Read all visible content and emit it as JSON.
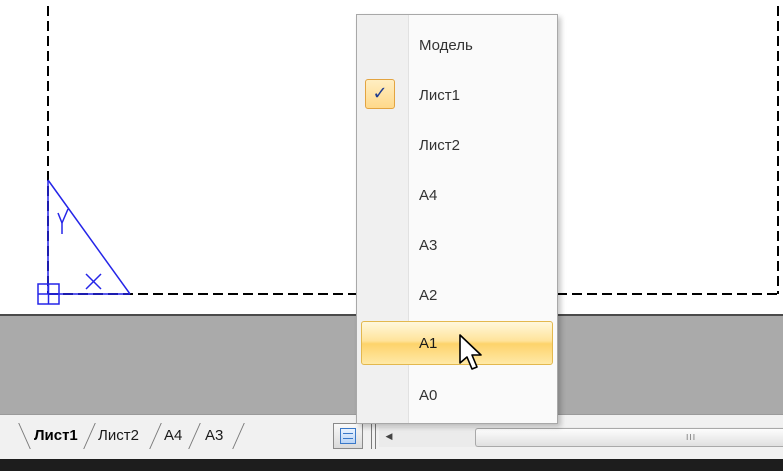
{
  "sheet_list_menu": {
    "items": [
      {
        "label": "Модель",
        "checked": false,
        "hover": false
      },
      {
        "label": "Лист1",
        "checked": true,
        "hover": false
      },
      {
        "label": "Лист2",
        "checked": false,
        "hover": false
      },
      {
        "label": "A4",
        "checked": false,
        "hover": false
      },
      {
        "label": "A3",
        "checked": false,
        "hover": false
      },
      {
        "label": "A2",
        "checked": false,
        "hover": false
      },
      {
        "label": "A1",
        "checked": false,
        "hover": true
      },
      {
        "label": "A0",
        "checked": false,
        "hover": false
      }
    ],
    "check_glyph": "✓"
  },
  "tab_bar": {
    "tabs": [
      {
        "label": "Лист1",
        "active": true
      },
      {
        "label": "Лист2",
        "active": false
      },
      {
        "label": "A4",
        "active": false
      },
      {
        "label": "A3",
        "active": false
      }
    ],
    "scroll_left_glyph": "◀",
    "scroll_grip_glyph": "III"
  },
  "icons": {
    "tab_list": "sheet-list-icon",
    "cursor": "mouse-pointer-icon",
    "ucs": "ucs-icon"
  },
  "colors": {
    "drawing_line": "#2525e8",
    "workspace_gray": "#aaaaaa",
    "hover_gold": "#ffe39a",
    "check_blue": "#1f3c8f"
  }
}
